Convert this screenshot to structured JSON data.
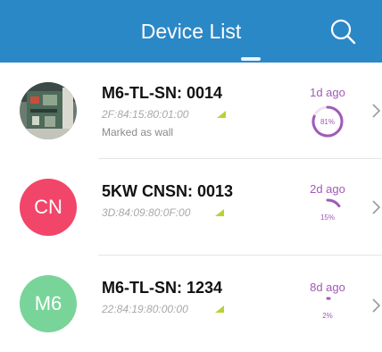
{
  "header": {
    "title": "Device List"
  },
  "devices": [
    {
      "name": "M6-TL-SN: 0014",
      "mac": "2F:84:15:80:01:00",
      "note": "Marked as wall",
      "avatar_type": "photo",
      "avatar_text": "",
      "avatar_color": "#5a6a5a",
      "ago": "1d ago",
      "percent": 81,
      "percent_label": "81%"
    },
    {
      "name": "5KW CNSN: 0013",
      "mac": "3D:84:09:80:0F:00",
      "note": "",
      "avatar_type": "initials",
      "avatar_text": "CN",
      "avatar_color": "#f2456a",
      "ago": "2d ago",
      "percent": 15,
      "percent_label": "15%"
    },
    {
      "name": "M6-TL-SN: 1234",
      "mac": "22:84:19:80:00:00",
      "note": "",
      "avatar_type": "initials",
      "avatar_text": "M6",
      "avatar_color": "#79d49a",
      "ago": "8d ago",
      "percent": 2,
      "percent_label": "2%"
    }
  ],
  "colors": {
    "header_bg": "#2b88c7",
    "accent": "#a05ab8",
    "signal": "#b6d335"
  },
  "icons": {
    "search": "search-icon",
    "chevron": "chevron-right-icon",
    "signal": "signal-icon"
  }
}
